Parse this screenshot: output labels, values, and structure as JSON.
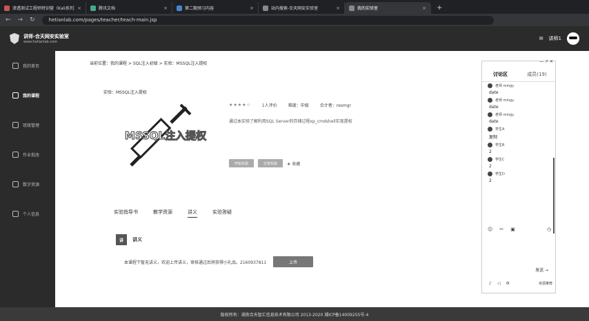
{
  "browser": {
    "tabs": [
      {
        "label": "渗透测试工程师特训营（Kali系列）"
      },
      {
        "label": "腾讯文档"
      },
      {
        "label": "第二期预习内容"
      },
      {
        "label": "站内搜索-合天网安实验室"
      },
      {
        "label": "我的实验室",
        "active": true
      }
    ],
    "new_tab": "+",
    "url": "hetianlab.com/pages/teacher/teach-main.jsp"
  },
  "site": {
    "logo_title": "讲师-合天网安实验室",
    "logo_sub": "www.hetianlab.com",
    "user_name": "讲师1"
  },
  "sidebar": {
    "items": [
      {
        "label": "我的首页",
        "icon": "home-icon"
      },
      {
        "label": "我的课程",
        "icon": "book-icon",
        "active": true
      },
      {
        "label": "班级管理",
        "icon": "class-icon"
      },
      {
        "label": "作业批改",
        "icon": "homework-icon"
      },
      {
        "label": "数字资源",
        "icon": "resource-icon"
      },
      {
        "label": "个人信息",
        "icon": "user-icon"
      }
    ]
  },
  "main": {
    "breadcrumb": "当前位置：我的课程 > SQL注入初级 > 实验：MSSQL注入提权",
    "experiment_title": "实验：MSSQL注入提权",
    "image_text": "MSSQL注入提权",
    "rating_stars": "★★★★☆",
    "participants": "1人评价",
    "difficulty": "难度：中级",
    "author": "合计者：resmgr",
    "description": "通过本实验了解利用SQL Server的存储过程xp_cmdshell实现提权",
    "btn_start": "开始实验",
    "btn_share": "分享实验",
    "favorite": "收藏",
    "tabs": [
      "实验指导书",
      "教学资源",
      "讲义",
      "实验答疑"
    ],
    "section_icon": "讲",
    "section_title": "讲义",
    "upload_msg": "本课程下暂无讲义，欢迎上传讲义，审核通过后将获得小礼品。2160937811",
    "upload_btn": "上传"
  },
  "chat": {
    "tools": "— ↗ ✕",
    "tab_discussion": "讨论区",
    "tab_members": "成员(19)",
    "messages": [
      {
        "user": "老师 mingy",
        "text": "date"
      },
      {
        "user": "老师 mingy",
        "text": "date"
      },
      {
        "user": "老师 mingy",
        "text": "date"
      },
      {
        "user": "学生A",
        "text": "复制"
      },
      {
        "user": "学生B",
        "text": "2"
      },
      {
        "user": "学生C",
        "text": "2"
      },
      {
        "user": "学生D",
        "text": "2"
      }
    ],
    "send": "发送 →",
    "footer_right": "资源推荐"
  },
  "footer": {
    "text": "版权所有：湖南合天智汇信息技术有限公司 2013-2020 湘ICP备14009255号-4"
  }
}
